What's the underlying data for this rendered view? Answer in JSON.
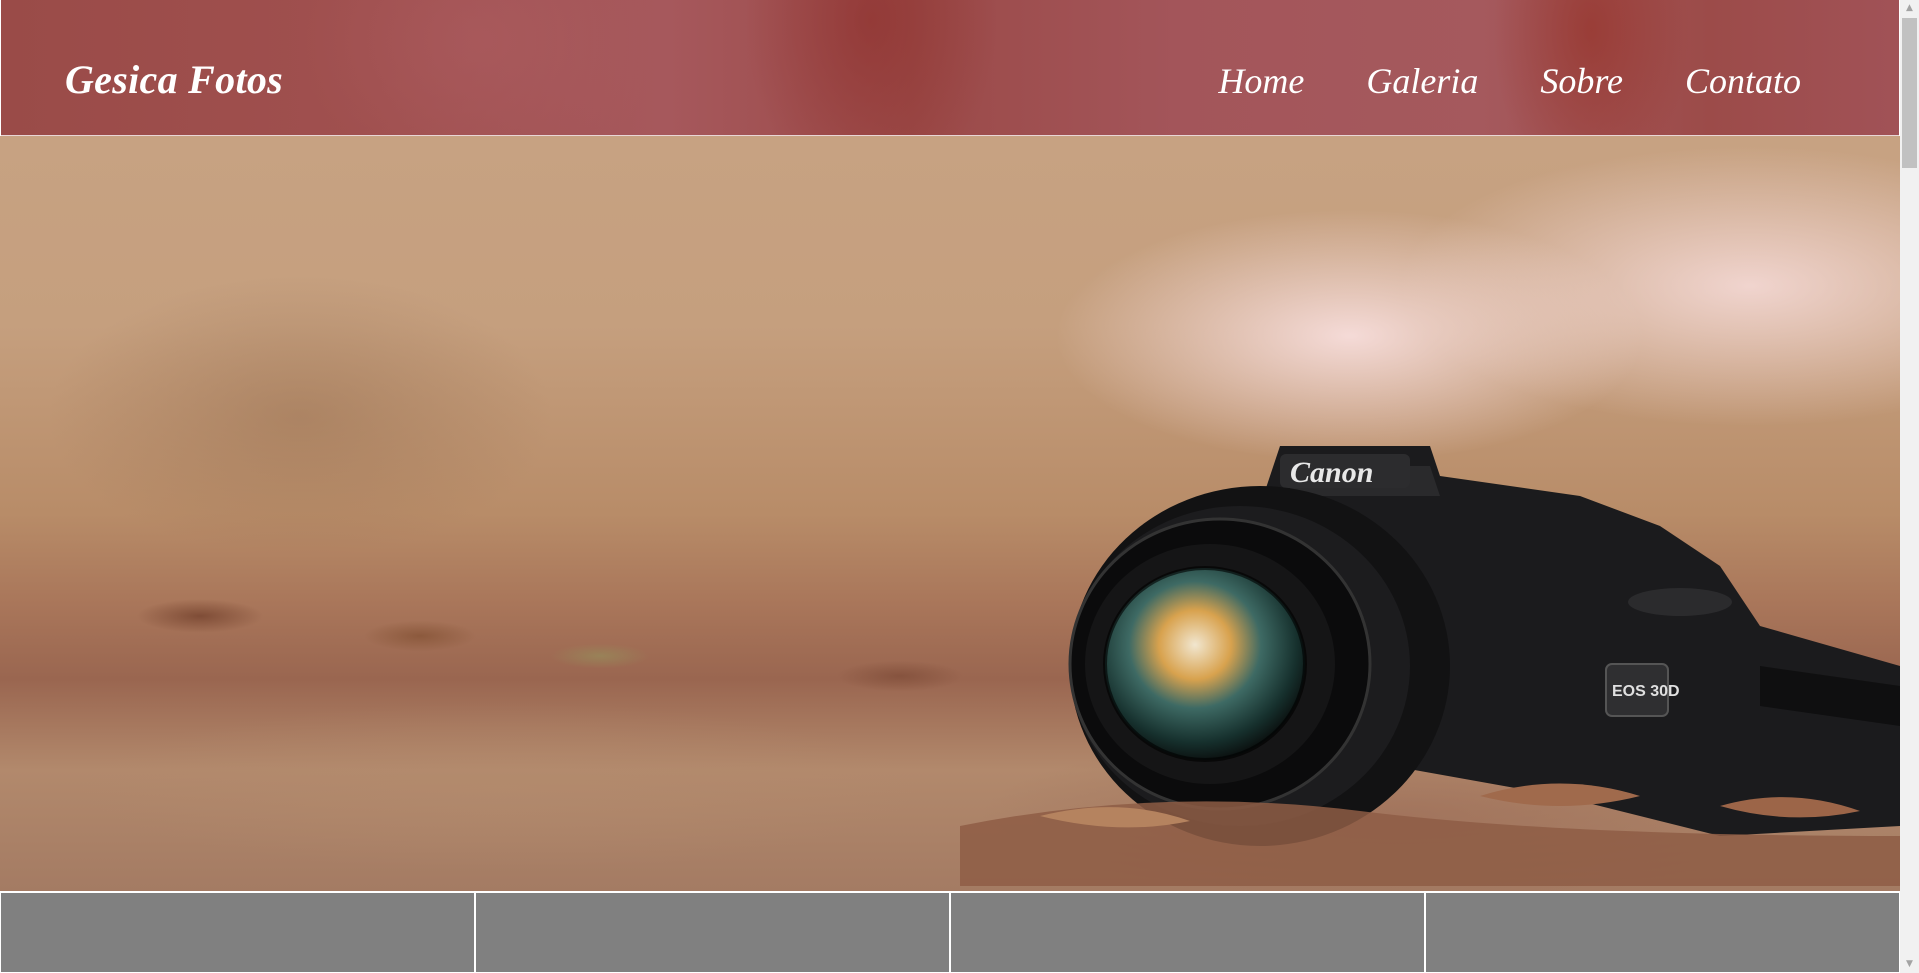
{
  "header": {
    "brand": "Gesica Fotos",
    "nav": [
      {
        "label": "Home"
      },
      {
        "label": "Galeria"
      },
      {
        "label": "Sobre"
      },
      {
        "label": "Contato"
      }
    ]
  },
  "hero": {
    "image": "camera-on-autumn-leaves",
    "camera_brand": "Canon",
    "camera_model": "EOS 30D"
  },
  "thumbnails": [
    {
      "name": "thumb-1"
    },
    {
      "name": "thumb-2"
    },
    {
      "name": "thumb-3"
    },
    {
      "name": "thumb-4"
    }
  ],
  "colors": {
    "header_bg": "#a0504f",
    "nav_text": "#ffffff",
    "thumb_bg": "#808080",
    "scrollbar_track": "#f1f1f1",
    "scrollbar_thumb": "#c1c1c1"
  },
  "scrollbar": {
    "up_icon": "▲",
    "down_icon": "▼"
  }
}
